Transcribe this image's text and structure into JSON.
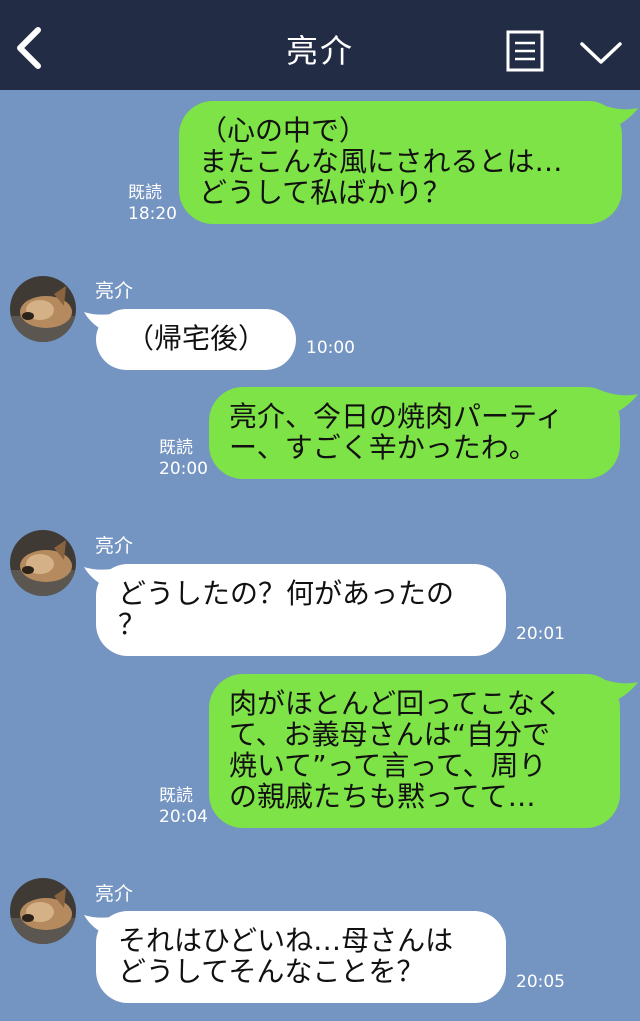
{
  "header": {
    "title": "亮介"
  },
  "messages": [
    {
      "side": "mine",
      "text": "（心の中で）\nまたこんな風にされるとは…\nどうして私ばかり？",
      "read": "既読",
      "time": "18:20"
    },
    {
      "side": "theirs",
      "sender": "亮介",
      "text": "（帰宅後）",
      "time": "10:00"
    },
    {
      "side": "mine",
      "text": "亮介、今日の焼肉パーティ\nー、すごく辛かったわ。",
      "read": "既読",
      "time": "20:00"
    },
    {
      "side": "theirs",
      "sender": "亮介",
      "text": "どうしたの？何があったの\n？",
      "time": "20:01"
    },
    {
      "side": "mine",
      "text": "肉がほとんど回ってこなく\nて、お義母さんは“自分で\n焼いて”って言って、周り\nの親戚たちも黙ってて…",
      "read": "既読",
      "time": "20:04"
    },
    {
      "side": "theirs",
      "sender": "亮介",
      "text": "それはひどいね…母さんは\nどうしてそんなことを？",
      "time": "20:05"
    }
  ],
  "colors": {
    "header": "#232c45",
    "background": "#7494c1",
    "mine_bubble": "#7ee346",
    "theirs_bubble": "#ffffff"
  },
  "icons": [
    "back-icon",
    "menu-icon",
    "chevron-down-icon",
    "dog-avatar"
  ]
}
